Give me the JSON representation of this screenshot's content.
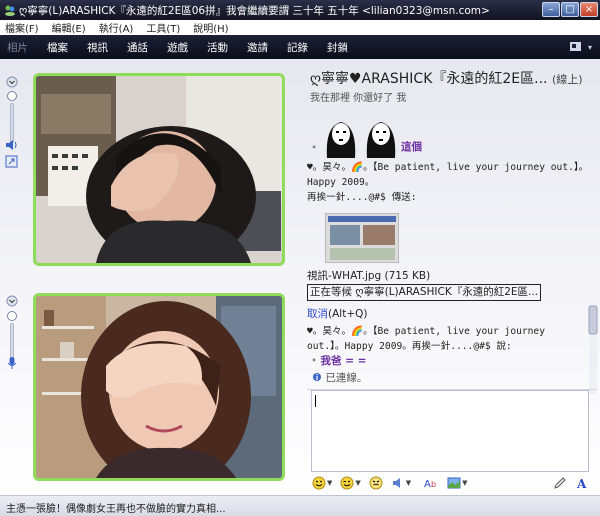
{
  "titlebar": {
    "title": "ღ寧寧(L)ARASHICK『永遠的紅2E區06拼』我會繼續要謂 三十年 五十年 <lilian0323@msn.com>",
    "buttons": [
      "–",
      "□",
      "×"
    ]
  },
  "menu": [
    "檔案(F)",
    "編輯(E)",
    "執行(A)",
    "工具(T)",
    "說明(H)"
  ],
  "toolbar": {
    "items": [
      "相片",
      "檔案",
      "視訊",
      "通話",
      "遊戲",
      "活動",
      "邀請",
      "記錄",
      "封鎖"
    ]
  },
  "contact": {
    "name": "ღ寧寧♥ARASHICK『永遠的紅2E區...",
    "status": "(線上)",
    "psm": "我在那裡 你還好了 我"
  },
  "chat": {
    "emoticon_caption": "這個",
    "msg1_line1": "♥。昊々。🌈。【Be patient, live your journey out.】。Happy 2009。",
    "msg1_line2": "再挨一針....@#$ 傳送:",
    "file_label": "視訊-WHAT.jpg (715 KB)",
    "waiting_text": "正在等候 ღ寧寧(L)ARASHICK『永遠的紅2E區...",
    "cancel_link": "取消",
    "cancel_shortcut": "(Alt+Q)",
    "msg2_line1": "♥。昊々。🌈。【Be patient, live your journey",
    "msg2_line2": "out.】。Happy 2009。再挨一針....@#$ 說:",
    "msg2_reply": "我爸 = =",
    "connected": "已連線。"
  },
  "statusbar": {
    "text": "主憑一張臉！偶像劇女王再也不做臉的實力真相..."
  },
  "colors": {
    "frame": "#8fdc5a",
    "toolbar": "#11131f",
    "link": "#2a46c9"
  }
}
